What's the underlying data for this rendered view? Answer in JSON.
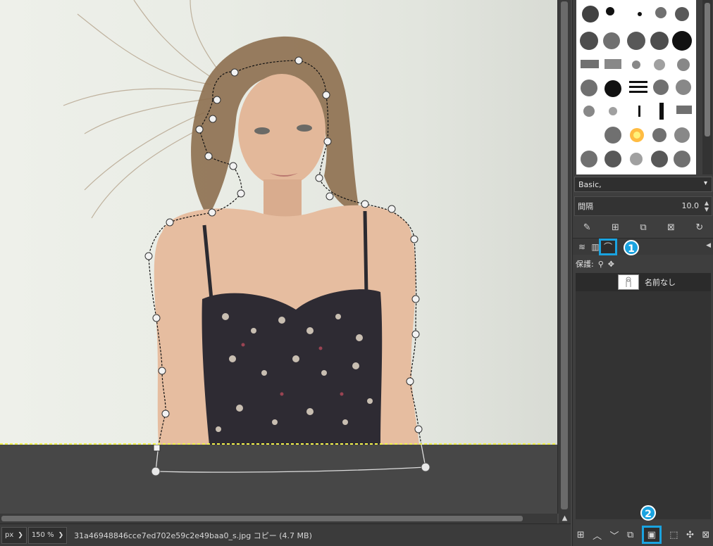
{
  "statusbar": {
    "unit": "px",
    "zoom": "150 %",
    "file_info": "31a46948846cce7ed702e59c2e49baa0_s.jpg コピー (4.7 MB)"
  },
  "brushes": {
    "preset_name": "Basic,",
    "spacing_label": "間隔",
    "spacing_value": "10.0"
  },
  "paths_panel": {
    "lock_label": "保護:",
    "path_name": "名前なし"
  },
  "badges": {
    "one": "1",
    "two": "2"
  },
  "colors": {
    "accent": "#1aa3e0",
    "dock_bg": "#3e3e3e",
    "selection": "#ffff66"
  },
  "icons": {
    "brush_actions": [
      "edit-brush-icon",
      "new-brush-icon",
      "duplicate-brush-icon",
      "delete-brush-icon",
      "refresh-icon"
    ],
    "tabs": [
      "layers-tab-icon",
      "channels-tab-icon",
      "paths-tab-icon",
      "panel-menu-icon"
    ],
    "bottom_actions": [
      "new-path-icon",
      "raise-path-icon",
      "lower-path-icon",
      "duplicate-path-icon",
      "path-to-selection-icon",
      "selection-to-path-icon",
      "paint-along-path-icon",
      "delete-path-icon"
    ]
  }
}
